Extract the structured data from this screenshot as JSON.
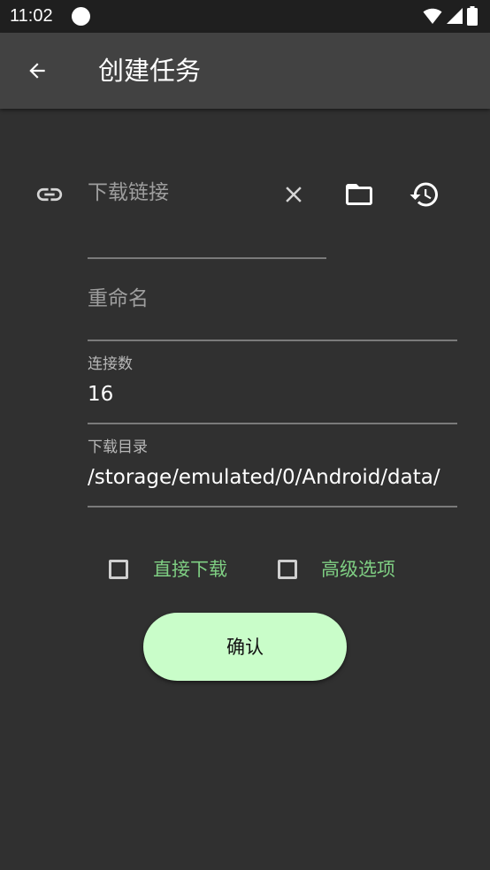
{
  "status_bar": {
    "time": "11:02"
  },
  "app_bar": {
    "title": "创建任务"
  },
  "icons": {
    "back": "arrow-left-icon",
    "link": "link-icon",
    "clear": "close-icon",
    "folder": "folder-icon",
    "history": "history-icon",
    "wifi": "wifi-icon",
    "signal": "cellular-signal-icon",
    "battery": "battery-icon"
  },
  "form": {
    "url": {
      "placeholder": "下载链接",
      "value": ""
    },
    "rename": {
      "placeholder": "重命名",
      "value": ""
    },
    "connections": {
      "label": "连接数",
      "value": "16"
    },
    "directory": {
      "label": "下载目录",
      "value": "/storage/emulated/0/Android/data/"
    }
  },
  "options": {
    "direct_download": {
      "label": "直接下载",
      "checked": false
    },
    "advanced": {
      "label": "高级选项",
      "checked": false
    }
  },
  "actions": {
    "confirm_label": "确认"
  },
  "colors": {
    "background": "#303030",
    "app_bar": "#424242",
    "accent_text": "#7fcf83",
    "button": "#c9fdc9"
  }
}
